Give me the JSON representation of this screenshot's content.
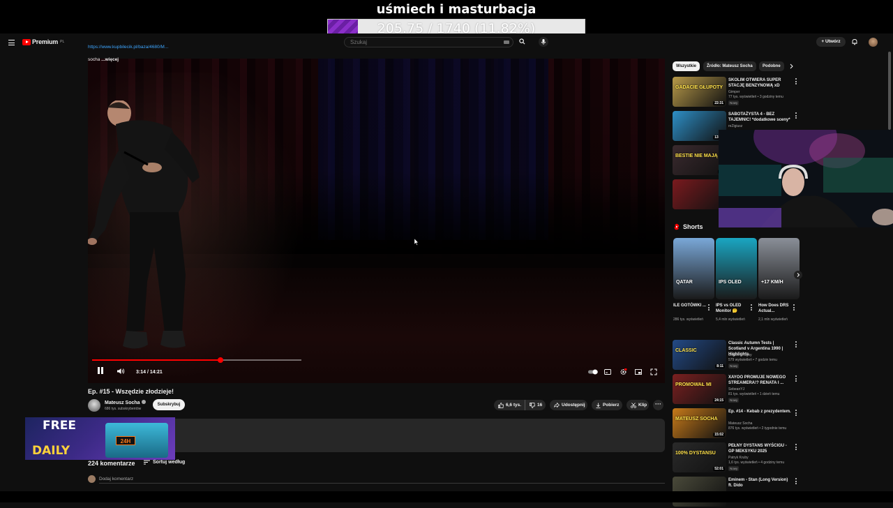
{
  "stream_overlay": {
    "goal_title": "uśmiech i masturbacja",
    "goal_text": "205.75 / 1740 (11.82%)",
    "goal_fraction": 0.1182
  },
  "header": {
    "logo_text": "Premium",
    "logo_region": "PL",
    "search_placeholder": "Szukaj",
    "create_label": "Utwórz"
  },
  "player": {
    "current_time": "3:14",
    "duration": "14:21",
    "progress_fraction": 0.614
  },
  "video": {
    "title": "Ep. #15 - Wszędzie złodzieje!",
    "channel": "Mateusz Socha",
    "subscribers": "686 tys. subskrybentów",
    "subscribe_label": "Subskrybuj",
    "likes": "6,6 tys.",
    "dislikes": "16",
    "share_label": "Udostępnij",
    "download_label": "Pobierz",
    "clip_label": "Klip",
    "description_link": "https://www.kupbilecik.pl/baza/4680/M...",
    "description_more_prefix": "socha",
    "description_more": "...więcej",
    "comments_count": "224 komentarze",
    "sort_label": "Sortuj według",
    "add_comment": "Dodaj komentarz"
  },
  "ad_overlay": {
    "free": "FREE",
    "daily": "DAILY",
    "badge": "24H"
  },
  "chips": [
    "Wszystkie",
    "Źródło: Mateusz Socha",
    "Podobne"
  ],
  "related_top": [
    {
      "title": "SKOLIM OTWIERA SUPER STACJĘ BENZYNOWĄ xD",
      "channel": "Gimper",
      "meta": "77 tys. wyświetleń • 3 godziny temu",
      "badge": "Nowy",
      "duration": "22:31",
      "thumb_text": "GADACIE GŁUPOTY",
      "color": "#b89a4a"
    },
    {
      "title": "SABOTAŻYSTA 4 - BEZ TAJEMNIC! *dodatkowe sceny*",
      "channel": "reZigiusz",
      "meta": "",
      "badge": "",
      "duration": "13:57",
      "thumb_text": "",
      "color": "#2e8fc7"
    },
    {
      "title": "",
      "channel": "",
      "meta": "",
      "badge": "",
      "duration": "27",
      "thumb_text": "BESTIE NIE MAJĄ L...",
      "color": "#3a2a2e"
    },
    {
      "title": "",
      "channel": "",
      "meta": "",
      "badge": "",
      "duration": "4",
      "thumb_text": "",
      "color": "#7a1a1e"
    }
  ],
  "shorts": {
    "header": "Shorts",
    "items": [
      {
        "title": "ILE GOTÓWKI ...",
        "views": "286 tys. wyświetleń",
        "color": "#7aa8d8",
        "overlay": "QATAR"
      },
      {
        "title": "IPS vs OLED Monitor 🤔",
        "views": "5,4 mln wyświetleń",
        "color": "#1aa6c2",
        "overlay": "IPS  OLED"
      },
      {
        "title": "How Does DRS Actual...",
        "views": "2,1 mln wyświetleń",
        "color": "#8a8f98",
        "overlay": "+17 KM/H"
      }
    ]
  },
  "related_bottom": [
    {
      "title": "Classic Autumn Tests | Scotland v Argentina 1990 | Highlights",
      "channel": "Scottish Rugby",
      "meta": "579 wyświetleń • 7 godzin temu",
      "badge": "Nowy",
      "duration": "8:11",
      "thumb_text": "CLASSIC",
      "color": "#234a86"
    },
    {
      "title": "XAYOO PROMUJE NOWEGO STREAMERA!? RENATA I ...",
      "channel": "SebeanYJ",
      "meta": "81 tys. wyświetleń • 1 dzień temu",
      "badge": "Nowy",
      "duration": "24:15",
      "thumb_text": "PROMOWAŁ MI",
      "color": "#7a2020"
    },
    {
      "title": "Ep. #14 - Kebab z prezydentem.",
      "channel": "Mateusz Socha",
      "meta": "876 tys. wyświetleń • 2 tygodnie temu",
      "badge": "",
      "duration": "15:02",
      "thumb_text": "MATEUSZ SOCHA",
      "color": "#c77a1a"
    },
    {
      "title": "PEŁNY DYSTANS WYŚCIGU - GP MEKSYKU 2025",
      "channel": "Patryk Kruby",
      "meta": "1,6 tys. wyświetleń • 4 godziny temu",
      "badge": "Nowy",
      "duration": "52:01",
      "thumb_text": "100% DYSTANSU",
      "color": "#2a2a2a"
    },
    {
      "title": "Eminem - Stan (Long Version) ft. Dido",
      "channel": "",
      "meta": "",
      "badge": "",
      "duration": "",
      "thumb_text": "",
      "color": "#4a4a3a"
    }
  ]
}
